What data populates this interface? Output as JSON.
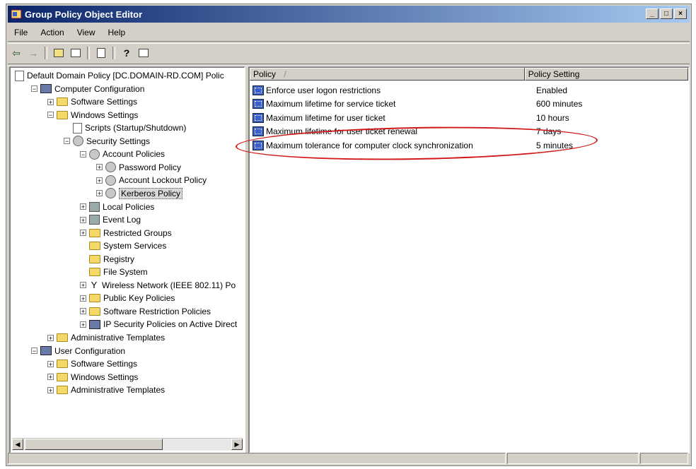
{
  "window": {
    "title": "Group Policy Object Editor"
  },
  "menu": [
    "File",
    "Action",
    "View",
    "Help"
  ],
  "tree": [
    {
      "label": "Default Domain Policy [DC.DOMAIN-RD.COM] Polic",
      "depth": 0,
      "icon": "policy-icon",
      "expander": "none"
    },
    {
      "label": "Computer Configuration",
      "depth": 1,
      "icon": "computer-icon",
      "expander": "minus"
    },
    {
      "label": "Software Settings",
      "depth": 2,
      "icon": "folder-icon",
      "expander": "plus"
    },
    {
      "label": "Windows Settings",
      "depth": 2,
      "icon": "folder-icon",
      "expander": "minus"
    },
    {
      "label": "Scripts (Startup/Shutdown)",
      "depth": 3,
      "icon": "script-icon",
      "expander": "none"
    },
    {
      "label": "Security Settings",
      "depth": 3,
      "icon": "security-icon",
      "expander": "minus"
    },
    {
      "label": "Account Policies",
      "depth": 4,
      "icon": "security-icon",
      "expander": "minus"
    },
    {
      "label": "Password Policy",
      "depth": 5,
      "icon": "security-icon",
      "expander": "plus"
    },
    {
      "label": "Account Lockout Policy",
      "depth": 5,
      "icon": "security-icon",
      "expander": "plus"
    },
    {
      "label": "Kerberos Policy",
      "depth": 5,
      "icon": "security-icon",
      "expander": "plus",
      "selected": true
    },
    {
      "label": "Local Policies",
      "depth": 4,
      "icon": "book-icon",
      "expander": "plus"
    },
    {
      "label": "Event Log",
      "depth": 4,
      "icon": "book-icon",
      "expander": "plus"
    },
    {
      "label": "Restricted Groups",
      "depth": 4,
      "icon": "folder-icon",
      "expander": "plus"
    },
    {
      "label": "System Services",
      "depth": 4,
      "icon": "folder-icon",
      "expander": "none"
    },
    {
      "label": "Registry",
      "depth": 4,
      "icon": "folder-icon",
      "expander": "none"
    },
    {
      "label": "File System",
      "depth": 4,
      "icon": "folder-icon",
      "expander": "none"
    },
    {
      "label": "Wireless Network (IEEE 802.11) Po",
      "depth": 4,
      "icon": "antenna-icon",
      "expander": "plus"
    },
    {
      "label": "Public Key Policies",
      "depth": 4,
      "icon": "folder-icon",
      "expander": "plus"
    },
    {
      "label": "Software Restriction Policies",
      "depth": 4,
      "icon": "folder-icon",
      "expander": "plus"
    },
    {
      "label": "IP Security Policies on Active Direct",
      "depth": 4,
      "icon": "ipsec-icon",
      "expander": "plus"
    },
    {
      "label": "Administrative Templates",
      "depth": 2,
      "icon": "folder-icon",
      "expander": "plus"
    },
    {
      "label": "User Configuration",
      "depth": 1,
      "icon": "user-icon",
      "expander": "minus"
    },
    {
      "label": "Software Settings",
      "depth": 2,
      "icon": "folder-icon",
      "expander": "plus"
    },
    {
      "label": "Windows Settings",
      "depth": 2,
      "icon": "folder-icon",
      "expander": "plus"
    },
    {
      "label": "Administrative Templates",
      "depth": 2,
      "icon": "folder-icon",
      "expander": "plus"
    }
  ],
  "list": {
    "columns": [
      "Policy",
      "Policy Setting"
    ],
    "rows": [
      {
        "policy": "Enforce user logon restrictions",
        "setting": "Enabled"
      },
      {
        "policy": "Maximum lifetime for service ticket",
        "setting": "600 minutes"
      },
      {
        "policy": "Maximum lifetime for user ticket",
        "setting": "10 hours"
      },
      {
        "policy": "Maximum lifetime for user ticket renewal",
        "setting": "7 days"
      },
      {
        "policy": "Maximum tolerance for computer clock synchronization",
        "setting": "5 minutes",
        "highlighted": true
      }
    ]
  },
  "colors": {
    "titlebar_start": "#0a246a",
    "titlebar_end": "#a6caf0",
    "highlight_ellipse": "#d01818"
  }
}
